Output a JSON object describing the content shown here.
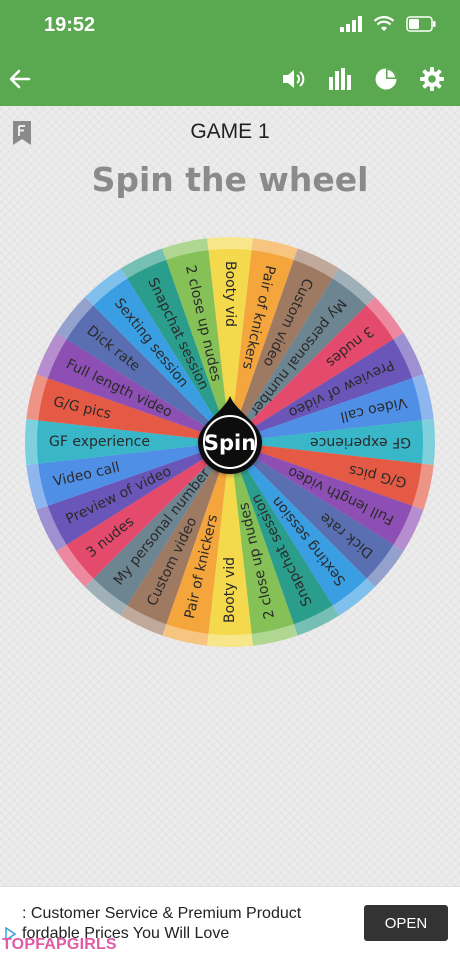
{
  "status_bar": {
    "time": "19:52",
    "icons": [
      "signal-icon",
      "wifi-icon",
      "battery-icon"
    ]
  },
  "app_bar": {
    "color": "#5aa84f",
    "buttons": [
      "back-arrow-icon",
      "volume-icon",
      "stats-icon",
      "pie-chart-icon",
      "settings-gear-icon"
    ]
  },
  "game": {
    "title": "GAME 1",
    "heading": "Spin the wheel",
    "spin_label": "Spin"
  },
  "wheel": {
    "segments": [
      {
        "label": "Booty vid",
        "color": "#f3d94b"
      },
      {
        "label": "Pair of knickers",
        "color": "#f4a63c"
      },
      {
        "label": "Custom video",
        "color": "#9e7a63"
      },
      {
        "label": "My personal number",
        "color": "#6d8591"
      },
      {
        "label": "3 nudes",
        "color": "#e34a6b"
      },
      {
        "label": "Preview of video",
        "color": "#6a56b8"
      },
      {
        "label": "Video call",
        "color": "#4f8fe6"
      },
      {
        "label": "GF experience",
        "color": "#39b7c9"
      },
      {
        "label": "G/G pics",
        "color": "#e55a45"
      },
      {
        "label": "Full length video",
        "color": "#8e4fb5"
      },
      {
        "label": "Dick rate",
        "color": "#5a6fb2"
      },
      {
        "label": "Sexting session",
        "color": "#3a9ee3"
      },
      {
        "label": "Snapchat session",
        "color": "#2b9d8c"
      },
      {
        "label": "2 close up nudes",
        "color": "#86c157"
      },
      {
        "label": "Booty vid",
        "color": "#f3d94b"
      },
      {
        "label": "Pair of knickers",
        "color": "#f4a63c"
      },
      {
        "label": "Custom video",
        "color": "#9e7a63"
      },
      {
        "label": "My personal number",
        "color": "#6d8591"
      },
      {
        "label": "3 nudes",
        "color": "#e34a6b"
      },
      {
        "label": "Preview of video",
        "color": "#6a56b8"
      },
      {
        "label": "Video call",
        "color": "#4f8fe6"
      },
      {
        "label": "GF experience",
        "color": "#39b7c9"
      },
      {
        "label": "G/G pics",
        "color": "#e55a45"
      },
      {
        "label": "Full length video",
        "color": "#8e4fb5"
      },
      {
        "label": "Dick rate",
        "color": "#5a6fb2"
      },
      {
        "label": "Sexting session",
        "color": "#3a9ee3"
      },
      {
        "label": "Snapchat session",
        "color": "#2b9d8c"
      },
      {
        "label": "2 close up nudes",
        "color": "#86c157"
      }
    ]
  },
  "ad": {
    "line1": ": Customer Service & Premium Product",
    "line2": "fordable Prices You Will Love",
    "button": "OPEN"
  },
  "watermark": "TOPFAPGIRLS"
}
